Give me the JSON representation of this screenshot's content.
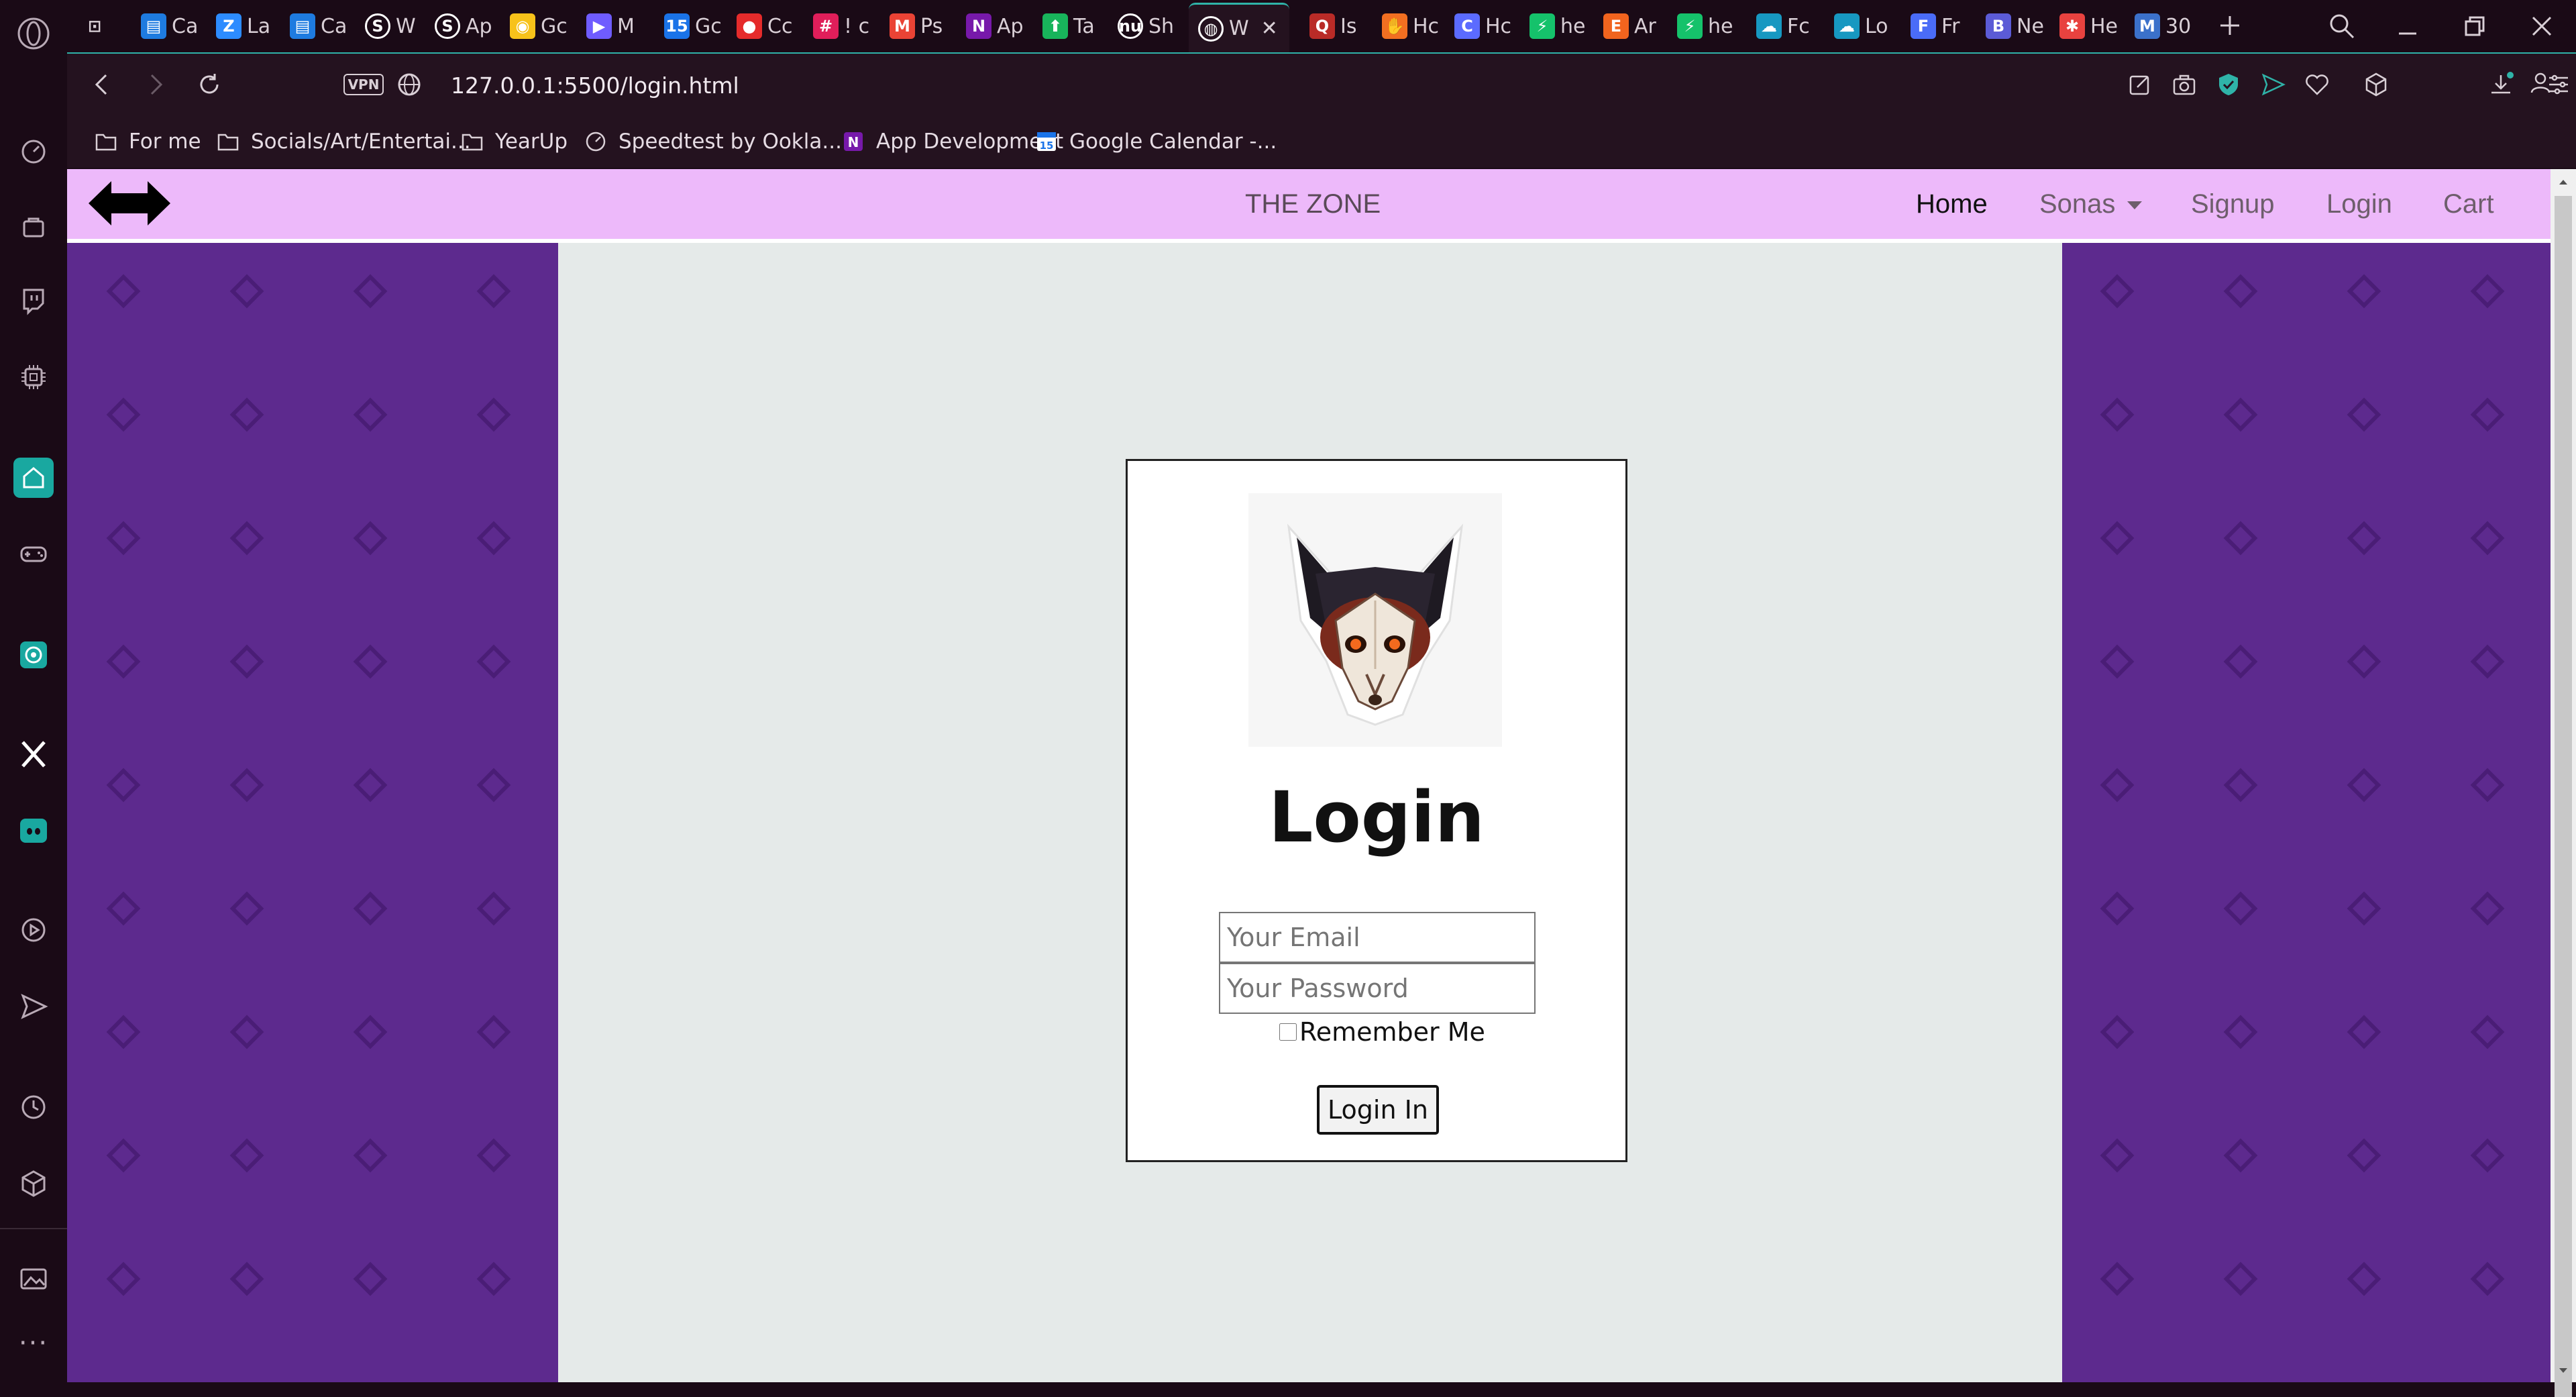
{
  "browser": {
    "tabs": [
      {
        "icon": "gamepad-icon",
        "label": ""
      },
      {
        "icon": "doc-icon",
        "label": "Ca",
        "color": "#1e7be0"
      },
      {
        "icon": "zoom-icon",
        "label": "La",
        "color": "#2d8cff"
      },
      {
        "icon": "doc-icon",
        "label": "Ca",
        "color": "#1e7be0"
      },
      {
        "icon": "s-icon",
        "label": "W",
        "color": "#ffffff"
      },
      {
        "icon": "s-icon",
        "label": "Ap",
        "color": "#ffffff"
      },
      {
        "icon": "idea-icon",
        "label": "Gc",
        "color": "#f7c21a"
      },
      {
        "icon": "play-icon",
        "label": "M",
        "color": "#6f5cff"
      },
      {
        "icon": "calendar-icon",
        "label": "Gc",
        "color": "#1a73e8"
      },
      {
        "icon": "record-icon",
        "label": "Cc",
        "color": "#e52b2b"
      },
      {
        "icon": "slack-icon",
        "label": "! c",
        "color": "#e01e5a"
      },
      {
        "icon": "gmail-icon",
        "label": "Ps",
        "color": "#ea4335"
      },
      {
        "icon": "onenote-icon",
        "label": "Ap",
        "color": "#7719aa"
      },
      {
        "icon": "arrow-up-icon",
        "label": "Ta",
        "color": "#18b45b"
      },
      {
        "icon": "nu-icon",
        "label": "Sh",
        "color": "#ffffff"
      },
      {
        "icon": "globe-icon",
        "label": "W",
        "color": "#ffffff",
        "active": true
      },
      {
        "icon": "quora-icon",
        "label": "Is",
        "color": "#b92b27"
      },
      {
        "icon": "hand-icon",
        "label": "Hc",
        "color": "#f26f21"
      },
      {
        "icon": "c-icon",
        "label": "Hc",
        "color": "#5b6bff"
      },
      {
        "icon": "bolt-icon",
        "label": "he",
        "color": "#15c26b"
      },
      {
        "icon": "etsy-icon",
        "label": "Ar",
        "color": "#f1641e"
      },
      {
        "icon": "bolt-icon",
        "label": "he",
        "color": "#15c26b"
      },
      {
        "icon": "cloud-icon",
        "label": "Fc",
        "color": "#1798c1"
      },
      {
        "icon": "cloud-icon",
        "label": "Lo",
        "color": "#1798c1"
      },
      {
        "icon": "forms-icon",
        "label": "Fr",
        "color": "#4a6cf7"
      },
      {
        "icon": "b-icon",
        "label": "Ne",
        "color": "#5b5bd6"
      },
      {
        "icon": "asterisk-icon",
        "label": "He",
        "color": "#e8423f"
      },
      {
        "icon": "mdb-icon",
        "label": "30",
        "color": "#3b71ca"
      }
    ],
    "url": "127.0.0.1:5500/login.html",
    "vpn_label": "VPN",
    "bookmarks": [
      {
        "icon": "folder-icon",
        "label": "For me"
      },
      {
        "icon": "folder-icon",
        "label": "Socials/Art/Entertai..."
      },
      {
        "icon": "folder-icon",
        "label": "YearUp"
      },
      {
        "icon": "speedtest-icon",
        "label": "Speedtest by Ookla..."
      },
      {
        "icon": "onenote-icon",
        "label": "App Development"
      },
      {
        "icon": "calendar-icon",
        "label": "Google Calendar -..."
      }
    ],
    "accent_color": "#2fb3a8"
  },
  "site": {
    "brand_title": "THE ZONE",
    "nav": [
      {
        "label": "Home",
        "active": true
      },
      {
        "label": "Sonas",
        "dropdown": true
      },
      {
        "label": "Signup"
      },
      {
        "label": "Login"
      },
      {
        "label": "Cart"
      }
    ],
    "nav_bg": "#edb9fa",
    "pattern_color": "#5d2a8e",
    "content_bg": "#e5eae9"
  },
  "login": {
    "title": "Login",
    "email_placeholder": "Your Email",
    "password_placeholder": "Your Password",
    "remember_label": "Remember Me",
    "remember_checked": false,
    "button_label": "Login In"
  }
}
